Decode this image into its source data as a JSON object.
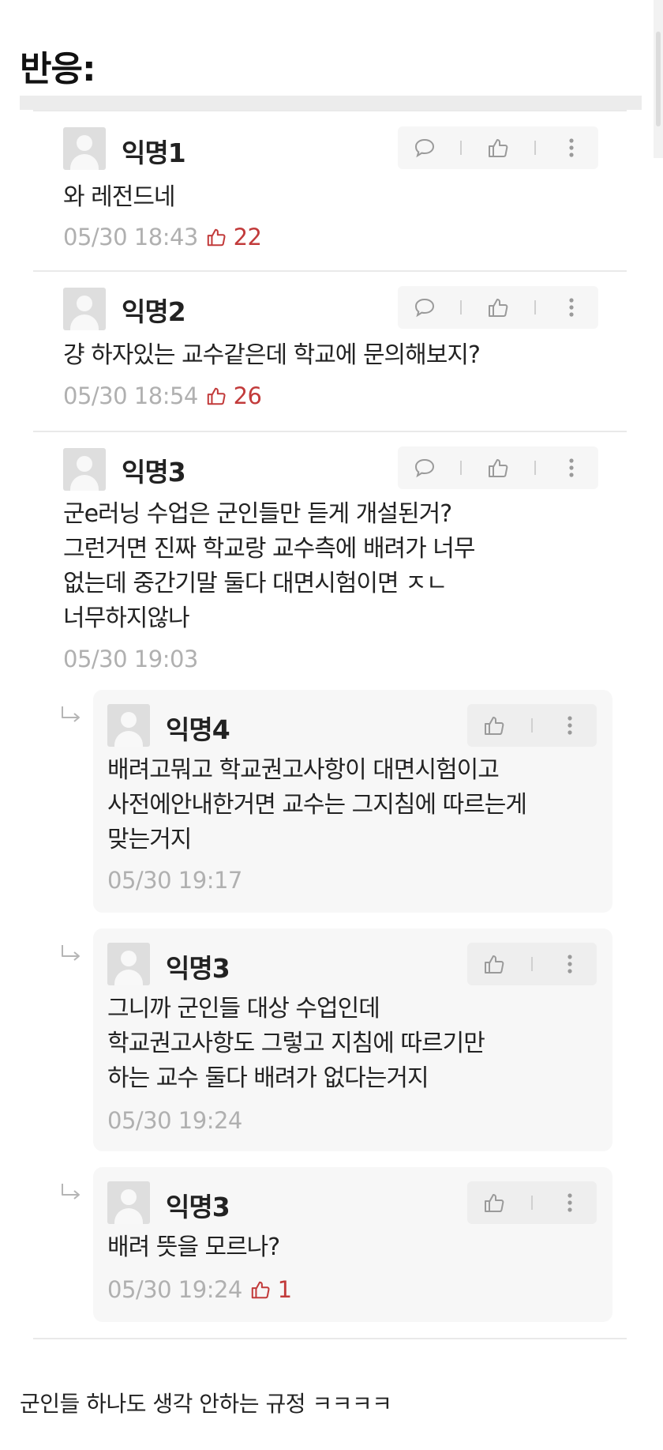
{
  "page": {
    "heading": "반응:",
    "footer_note": "군인들 하나도 생각 안하는 규정 ㅋㅋㅋㅋ"
  },
  "colors": {
    "like_red": "#c23b3b",
    "meta_gray": "#b0b0b0",
    "reply_bg": "#f7f7f7"
  },
  "comments": [
    {
      "author": "익명1",
      "lines": [
        "와 레전드네"
      ],
      "time": "05/30 18:43",
      "likes": "22"
    },
    {
      "author": "익명2",
      "lines": [
        "걍 하자있는 교수같은데 학교에 문의해보지?"
      ],
      "time": "05/30 18:54",
      "likes": "26"
    },
    {
      "author": "익명3",
      "lines": [
        "군e러닝 수업은 군인들만 듣게 개설된거?",
        "그런거면 진짜 학교랑 교수측에 배려가 너무",
        "없는데 중간기말 둘다 대면시험이면 ㅈㄴ",
        "너무하지않나"
      ],
      "time": "05/30 19:03"
    }
  ],
  "replies": [
    {
      "author": "익명4",
      "lines": [
        "배려고뭐고 학교권고사항이 대면시험이고",
        "사전에안내한거면 교수는 그지침에 따르는게",
        "맞는거지"
      ],
      "time": "05/30 19:17"
    },
    {
      "author": "익명3",
      "lines": [
        "그니까 군인들 대상 수업인데",
        "학교권고사항도 그렇고 지침에 따르기만",
        "하는 교수 둘다 배려가 없다는거지"
      ],
      "time": "05/30 19:24"
    },
    {
      "author": "익명3",
      "lines": [
        "배려 뜻을 모르나?"
      ],
      "time": "05/30 19:24",
      "likes": "1"
    }
  ]
}
